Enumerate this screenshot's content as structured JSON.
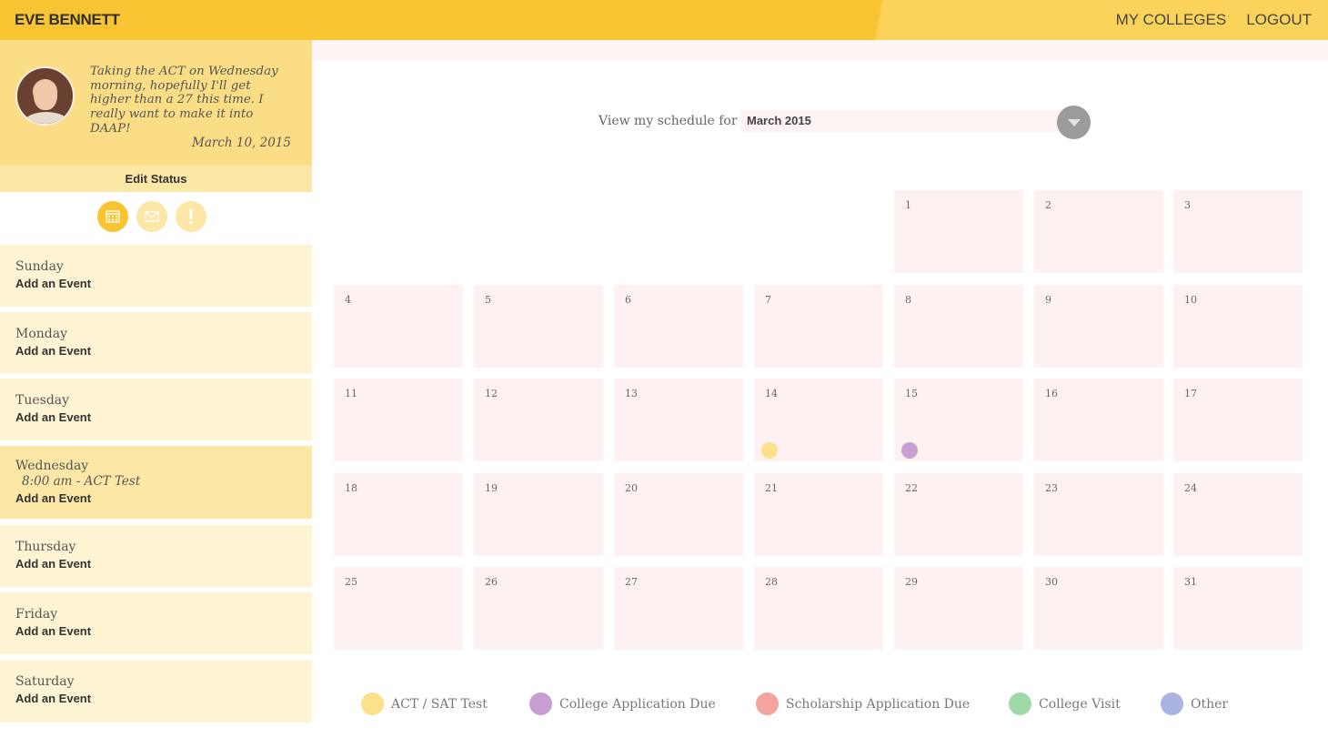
{
  "header": {
    "user_name": "EVE BENNETT",
    "nav": [
      "MY COLLEGES",
      "LOGOUT"
    ]
  },
  "status": {
    "text": "Taking the ACT on Wednesday morning, hopefully I'll get higher than a 27 this time. I really want to make it into DAAP!",
    "date": "March 10, 2015",
    "edit_label": "Edit Status"
  },
  "toolbar_icons": [
    {
      "name": "calendar-icon",
      "active": true
    },
    {
      "name": "mail-icon",
      "active": false
    },
    {
      "name": "alert-icon",
      "active": false
    }
  ],
  "week": [
    {
      "day": "Sunday",
      "events": [],
      "add_label": "Add an Event"
    },
    {
      "day": "Monday",
      "events": [],
      "add_label": "Add an Event"
    },
    {
      "day": "Tuesday",
      "events": [],
      "add_label": "Add an Event"
    },
    {
      "day": "Wednesday",
      "events": [
        "8:00 am - ACT Test"
      ],
      "add_label": "Add an Event"
    },
    {
      "day": "Thursday",
      "events": [],
      "add_label": "Add an Event"
    },
    {
      "day": "Friday",
      "events": [],
      "add_label": "Add an Event"
    },
    {
      "day": "Saturday",
      "events": [],
      "add_label": "Add an Event"
    }
  ],
  "schedule": {
    "label": "View my schedule for",
    "selected_month": "March 2015"
  },
  "calendar": {
    "first_weekday": 4,
    "days_in_month": 31,
    "events": [
      {
        "day": 14,
        "category": "ACT / SAT Test"
      },
      {
        "day": 15,
        "category": "College Application Due"
      }
    ]
  },
  "legend": [
    {
      "label": "ACT / SAT Test",
      "color": "#fde08a"
    },
    {
      "label": "College Application Due",
      "color": "#c79fd2"
    },
    {
      "label": "Scholarship Application Due",
      "color": "#f3a3a0"
    },
    {
      "label": "College Visit",
      "color": "#9fd9a8"
    },
    {
      "label": "Other",
      "color": "#aab4e3"
    }
  ],
  "colors": {
    "accent": "#f8c431",
    "status_bg": "#fbdd85",
    "day_bg": "#fef4d3",
    "cell_bg": "#fdf1f1"
  }
}
